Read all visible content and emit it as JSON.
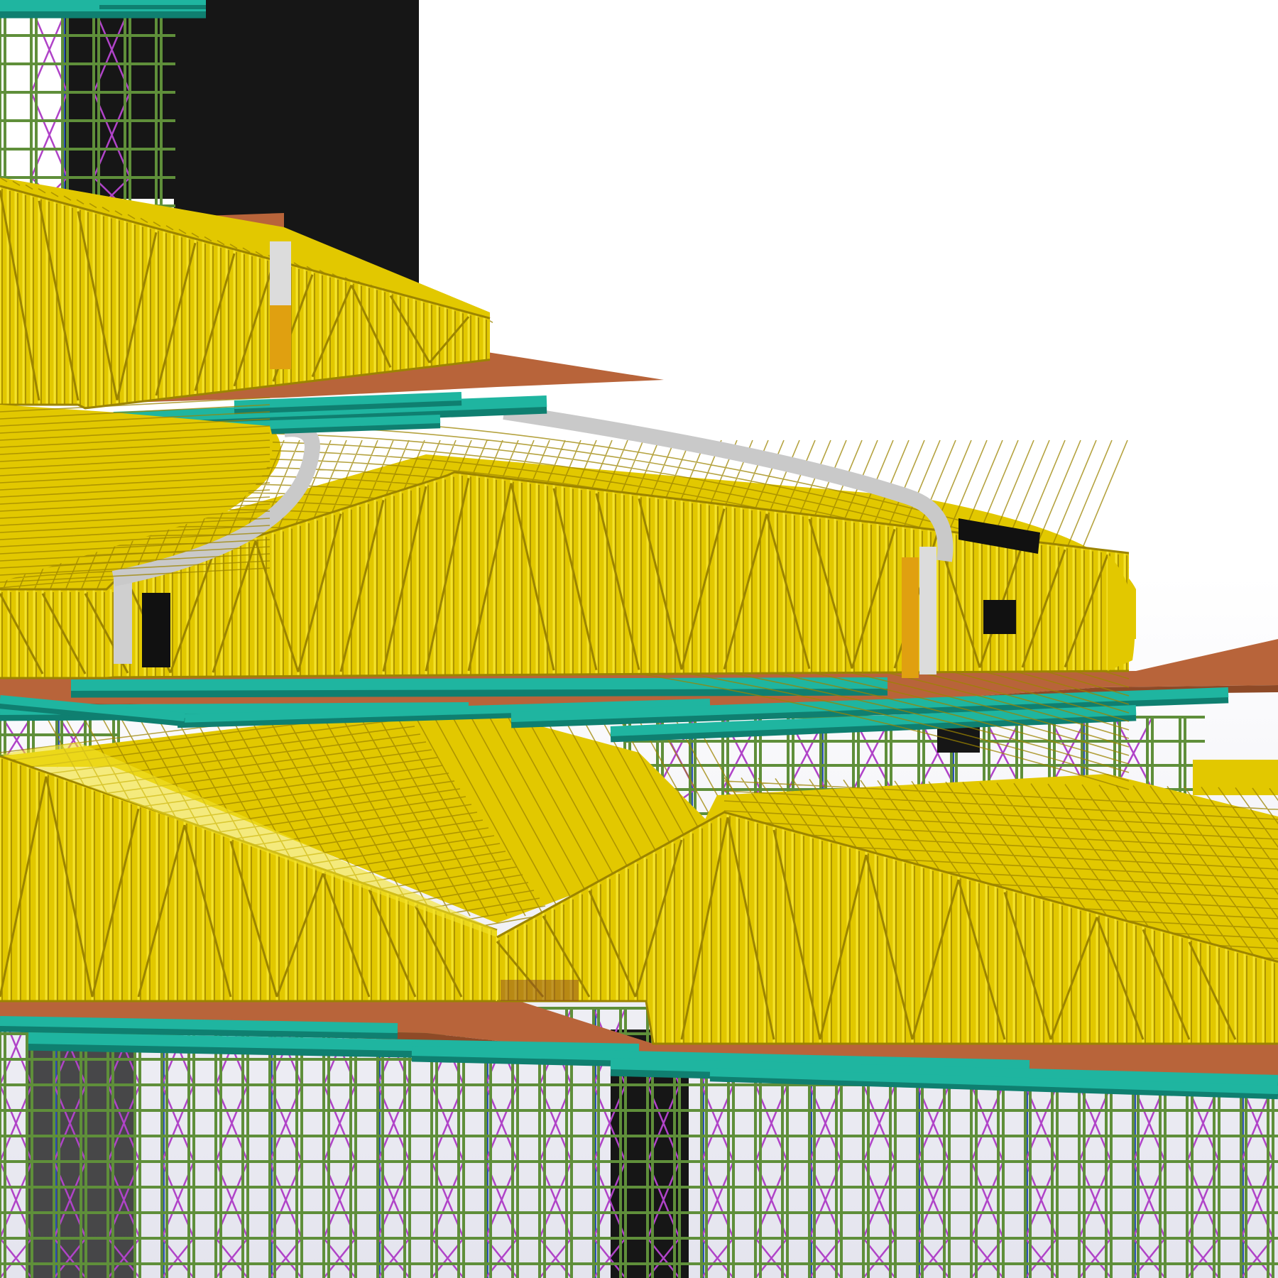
{
  "view": {
    "background_top": "#ffffff",
    "background_bottom": "#e4e4ee"
  },
  "colors": {
    "timber_frame": "#e2c800",
    "timber_frame_light": "#f4e22a",
    "timber_frame_dark": "#9c8400",
    "slab": "#b8643a",
    "slab_dark": "#8e4a27",
    "steel_beam": "#1fb5a0",
    "steel_beam_dark": "#0f7f70",
    "scaffold_post": "#5f8f3a",
    "scaffold_brace": "#b043c8",
    "scaffold_blue": "#2a4fb5",
    "core_wall": "#161616",
    "concrete_curb": "#c9c9c9",
    "door_opening": "#111111",
    "orange_stair": "#e0a010"
  },
  "layers": [
    {
      "name": "upper-scaffolding",
      "icon": "scaffold-icon"
    },
    {
      "name": "core-wall",
      "icon": "wall-icon"
    },
    {
      "name": "level-3-timber-frame",
      "icon": "timber-frame-icon"
    },
    {
      "name": "level-3-slab",
      "icon": "slab-icon"
    },
    {
      "name": "level-2-steel-beams",
      "icon": "beam-icon"
    },
    {
      "name": "level-2-timber-frame",
      "icon": "timber-frame-icon"
    },
    {
      "name": "level-2-curved-curb",
      "icon": "curb-icon"
    },
    {
      "name": "level-2-slab",
      "icon": "slab-icon"
    },
    {
      "name": "level-1-steel-beams",
      "icon": "beam-icon"
    },
    {
      "name": "level-1-scaffolding",
      "icon": "scaffold-icon"
    },
    {
      "name": "level-1-timber-frame",
      "icon": "timber-frame-icon"
    },
    {
      "name": "level-1-slab",
      "icon": "slab-icon"
    },
    {
      "name": "ground-scaffolding",
      "icon": "scaffold-icon"
    }
  ]
}
